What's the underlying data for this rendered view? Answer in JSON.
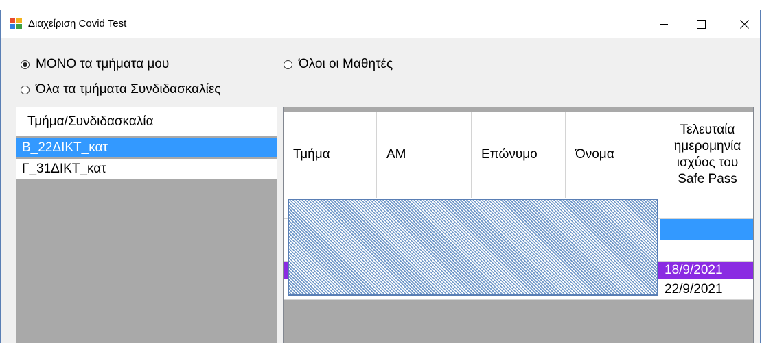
{
  "window": {
    "title": "Διαχείριση Covid Test",
    "minimize_icon": "minimize-icon",
    "maximize_icon": "maximize-icon",
    "close_icon": "close-icon"
  },
  "filters": {
    "options": [
      {
        "label": "ΜΟΝΟ τα τμήματα μου",
        "selected": true
      },
      {
        "label": "Όλοι οι Μαθητές",
        "selected": false
      },
      {
        "label": "Όλα τα τμήματα Συνδιδασκαλίες",
        "selected": false
      }
    ]
  },
  "classes_list": {
    "header": "Τμήμα/Συνδιδασκαλία",
    "items": [
      {
        "label": "Β_22ΔΙΚΤ_κατ",
        "selected": true
      },
      {
        "label": "Γ_31ΔΙΚΤ_κατ",
        "selected": false
      }
    ]
  },
  "students_grid": {
    "columns": [
      "Τμήμα",
      "ΑΜ",
      "Επώνυμο",
      "Όνομα",
      "Τελευταία ημερομηνία ισχύος του Safe Pass"
    ],
    "rows": [
      {
        "safe_pass": "",
        "state": "normal"
      },
      {
        "safe_pass": "",
        "state": "selected"
      },
      {
        "safe_pass": "",
        "state": "normal"
      },
      {
        "safe_pass": "18/9/2021",
        "state": "highlighted"
      },
      {
        "safe_pass": "22/9/2021",
        "state": "normal"
      }
    ],
    "colors": {
      "selected": "#3399ff",
      "highlighted": "#8a2be2"
    }
  }
}
